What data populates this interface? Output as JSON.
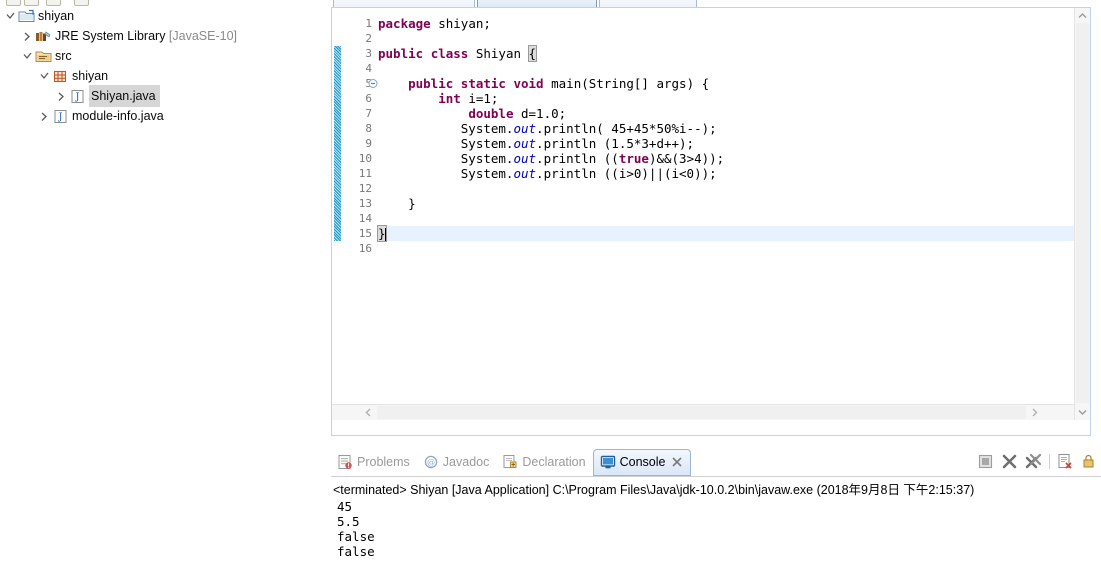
{
  "window": {
    "app": "Eclipse IDE",
    "theme_accent": "#3b6ea5"
  },
  "explorer": {
    "name": "Project Explorer",
    "items": [
      {
        "label": "shiyan",
        "sublabel": "",
        "icon": "java-project-icon",
        "indent": 0,
        "twisty": "expanded",
        "selected": false
      },
      {
        "label": "JRE System Library",
        "sublabel": "[JavaSE-10]",
        "icon": "library-icon",
        "indent": 1,
        "twisty": "collapsed",
        "selected": false
      },
      {
        "label": "src",
        "sublabel": "",
        "icon": "source-folder-icon",
        "indent": 1,
        "twisty": "expanded",
        "selected": false
      },
      {
        "label": "shiyan",
        "sublabel": "",
        "icon": "package-icon",
        "indent": 2,
        "twisty": "expanded",
        "selected": false
      },
      {
        "label": "Shiyan.java",
        "sublabel": "",
        "icon": "java-file-icon",
        "indent": 3,
        "twisty": "collapsed",
        "selected": true
      },
      {
        "label": "module-info.java",
        "sublabel": "",
        "icon": "java-file-icon",
        "indent": 2,
        "twisty": "collapsed",
        "selected": false
      }
    ]
  },
  "editor": {
    "file": "Shiyan.java",
    "caret_line": 15,
    "total_lines": 16,
    "line_numbers": [
      "1",
      "2",
      "3",
      "4",
      "5",
      "6",
      "7",
      "8",
      "9",
      "10",
      "11",
      "12",
      "13",
      "14",
      "15",
      "16"
    ],
    "fold_marker_line": 5,
    "change_stripe_from_line": 3,
    "change_stripe_to_line": 15,
    "lines": [
      {
        "n": 1,
        "tokens": [
          {
            "t": "package",
            "c": "kw"
          },
          {
            "t": " shiyan;",
            "c": ""
          }
        ]
      },
      {
        "n": 2,
        "tokens": []
      },
      {
        "n": 3,
        "tokens": [
          {
            "t": "public",
            "c": "kw"
          },
          {
            "t": " ",
            "c": ""
          },
          {
            "t": "class",
            "c": "kw"
          },
          {
            "t": " Shiyan ",
            "c": ""
          },
          {
            "t": "{",
            "c": "bracket-hl"
          }
        ]
      },
      {
        "n": 4,
        "tokens": []
      },
      {
        "n": 5,
        "tokens": [
          {
            "t": "    ",
            "c": ""
          },
          {
            "t": "public",
            "c": "kw"
          },
          {
            "t": " ",
            "c": ""
          },
          {
            "t": "static",
            "c": "kw"
          },
          {
            "t": " ",
            "c": ""
          },
          {
            "t": "void",
            "c": "kw"
          },
          {
            "t": " main(String[] args) {",
            "c": ""
          }
        ]
      },
      {
        "n": 6,
        "tokens": [
          {
            "t": "        ",
            "c": ""
          },
          {
            "t": "int",
            "c": "kw"
          },
          {
            "t": " i=1;",
            "c": ""
          }
        ]
      },
      {
        "n": 7,
        "tokens": [
          {
            "t": "            ",
            "c": ""
          },
          {
            "t": "double",
            "c": "kw"
          },
          {
            "t": " d=1.0;",
            "c": ""
          }
        ]
      },
      {
        "n": 8,
        "tokens": [
          {
            "t": "           System.",
            "c": ""
          },
          {
            "t": "out",
            "c": "fld"
          },
          {
            "t": ".println( 45+45*50%i--);",
            "c": ""
          }
        ]
      },
      {
        "n": 9,
        "tokens": [
          {
            "t": "           System.",
            "c": ""
          },
          {
            "t": "out",
            "c": "fld"
          },
          {
            "t": ".println (1.5*3+d++);",
            "c": ""
          }
        ]
      },
      {
        "n": 10,
        "tokens": [
          {
            "t": "           System.",
            "c": ""
          },
          {
            "t": "out",
            "c": "fld"
          },
          {
            "t": ".println ((",
            "c": ""
          },
          {
            "t": "true",
            "c": "kw"
          },
          {
            "t": ")&&(3>4));",
            "c": ""
          }
        ]
      },
      {
        "n": 11,
        "tokens": [
          {
            "t": "           System.",
            "c": ""
          },
          {
            "t": "out",
            "c": "fld"
          },
          {
            "t": ".println ((i>0)||(i<0));",
            "c": ""
          }
        ]
      },
      {
        "n": 12,
        "tokens": []
      },
      {
        "n": 13,
        "tokens": [
          {
            "t": "    }",
            "c": ""
          }
        ]
      },
      {
        "n": 14,
        "tokens": []
      },
      {
        "n": 15,
        "tokens": [
          {
            "t": "}",
            "c": "bracket-hl"
          }
        ],
        "caret": true
      },
      {
        "n": 16,
        "tokens": []
      }
    ],
    "scrollbars": {
      "vertical_up_icon": "chevron-up-icon",
      "vertical_down_icon": "chevron-down-icon",
      "horizontal_left_icon": "chevron-left-icon",
      "horizontal_right_icon": "chevron-right-icon"
    }
  },
  "console_view": {
    "tabs": [
      {
        "label": "Problems",
        "icon": "problems-icon",
        "active": false
      },
      {
        "label": "Javadoc",
        "icon": "javadoc-icon",
        "active": false
      },
      {
        "label": "Declaration",
        "icon": "declaration-icon",
        "active": false
      },
      {
        "label": "Console",
        "icon": "console-icon",
        "active": true,
        "closable": true
      }
    ],
    "toolbar": [
      {
        "name": "terminate-button",
        "icon": "stop-square-icon"
      },
      {
        "name": "remove-launch-button",
        "icon": "remove-x-icon"
      },
      {
        "name": "remove-all-launches-button",
        "icon": "remove-all-xx-icon"
      },
      {
        "name": "separator",
        "icon": "separator"
      },
      {
        "name": "clear-console-button",
        "icon": "clear-console-icon"
      },
      {
        "name": "scroll-lock-button",
        "icon": "scroll-lock-icon"
      }
    ],
    "terminated_line": "<terminated> Shiyan [Java Application] C:\\Program Files\\Java\\jdk-10.0.2\\bin\\javaw.exe (2018年9月8日 下午2:15:37)",
    "output": [
      "45",
      "5.5",
      "false",
      "false"
    ]
  }
}
